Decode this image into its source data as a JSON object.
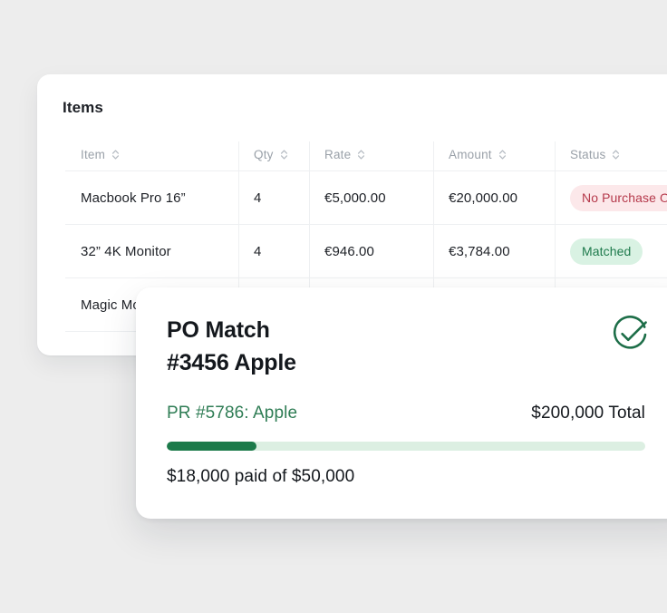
{
  "page": {
    "background_color": "#ededed"
  },
  "items_panel": {
    "title": "Items",
    "columns": [
      {
        "label": "Item",
        "sort_icon": "sort-chevrons-icon"
      },
      {
        "label": "Qty",
        "sort_icon": "sort-chevrons-icon"
      },
      {
        "label": "Rate",
        "sort_icon": "sort-chevrons-icon"
      },
      {
        "label": "Amount",
        "sort_icon": "sort-chevrons-icon"
      },
      {
        "label": "Status",
        "sort_icon": "sort-chevrons-icon"
      }
    ],
    "rows": [
      {
        "item": "Macbook Pro 16”",
        "qty": "4",
        "rate": "€5,000.00",
        "amount": "€20,000.00",
        "status": "No Purchase Order",
        "status_type": "danger",
        "status_bg": "#fce8ea",
        "status_color": "#b5394b"
      },
      {
        "item": "32” 4K Monitor",
        "qty": "4",
        "rate": "€946.00",
        "amount": "€3,784.00",
        "status": "Matched",
        "status_type": "success",
        "status_bg": "#d9f2e3",
        "status_color": "#1e7a4c"
      },
      {
        "item": "Magic Mouse",
        "qty": "",
        "rate": "",
        "amount": "",
        "status": "",
        "status_type": "none",
        "status_bg": "",
        "status_color": ""
      }
    ]
  },
  "po_card": {
    "title_line1": "PO Match",
    "title_line2": "#3456 Apple",
    "status_icon": "check-circle-icon",
    "status_icon_color": "#1d6e48",
    "pr_link": "PR #5786: Apple",
    "pr_link_color": "#2f7d55",
    "total": "$200,000 Total",
    "progress": {
      "percent": 18.7,
      "fill_color": "#1c7a4a",
      "track_color": "#dcefe2"
    },
    "paid_summary": "$18,000 paid of $50,000"
  }
}
